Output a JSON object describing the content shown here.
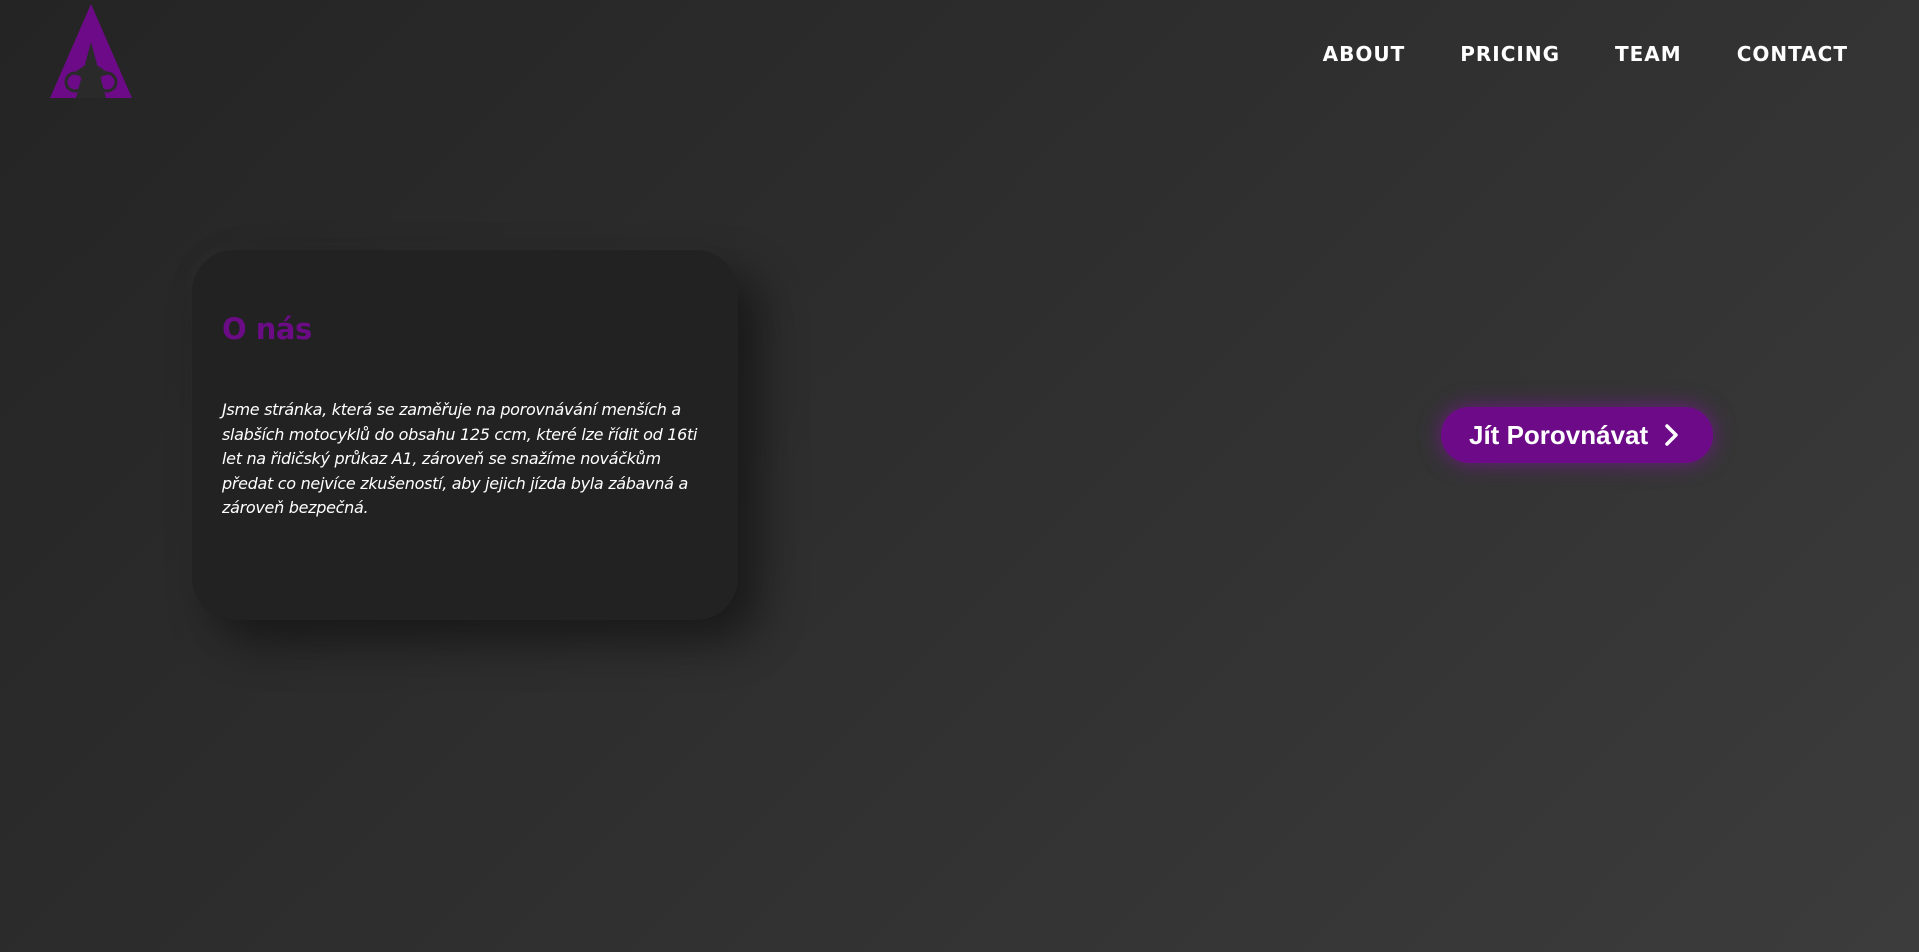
{
  "brand": {
    "logo_icon": "motorcycle-triangle-logo",
    "accent_color": "#6c0a88"
  },
  "nav": {
    "items": [
      {
        "label": "ABOUT"
      },
      {
        "label": "PRICING"
      },
      {
        "label": "TEAM"
      },
      {
        "label": "CONTACT"
      }
    ]
  },
  "about_card": {
    "title": "O nás",
    "text": "Jsme stránka, která se zaměřuje na porovnávání menších a slabších motocyklů do obsahu 125 ccm, které lze řídit od 16ti let na řidičský průkaz A1, zároveň se snažíme nováčkům předat co nejvíce zkušeností, aby jejich jízda byla zábavná a zároveň bezpečná."
  },
  "cta": {
    "label": "Jít Porovnávat",
    "icon": "chevron-right-icon"
  }
}
